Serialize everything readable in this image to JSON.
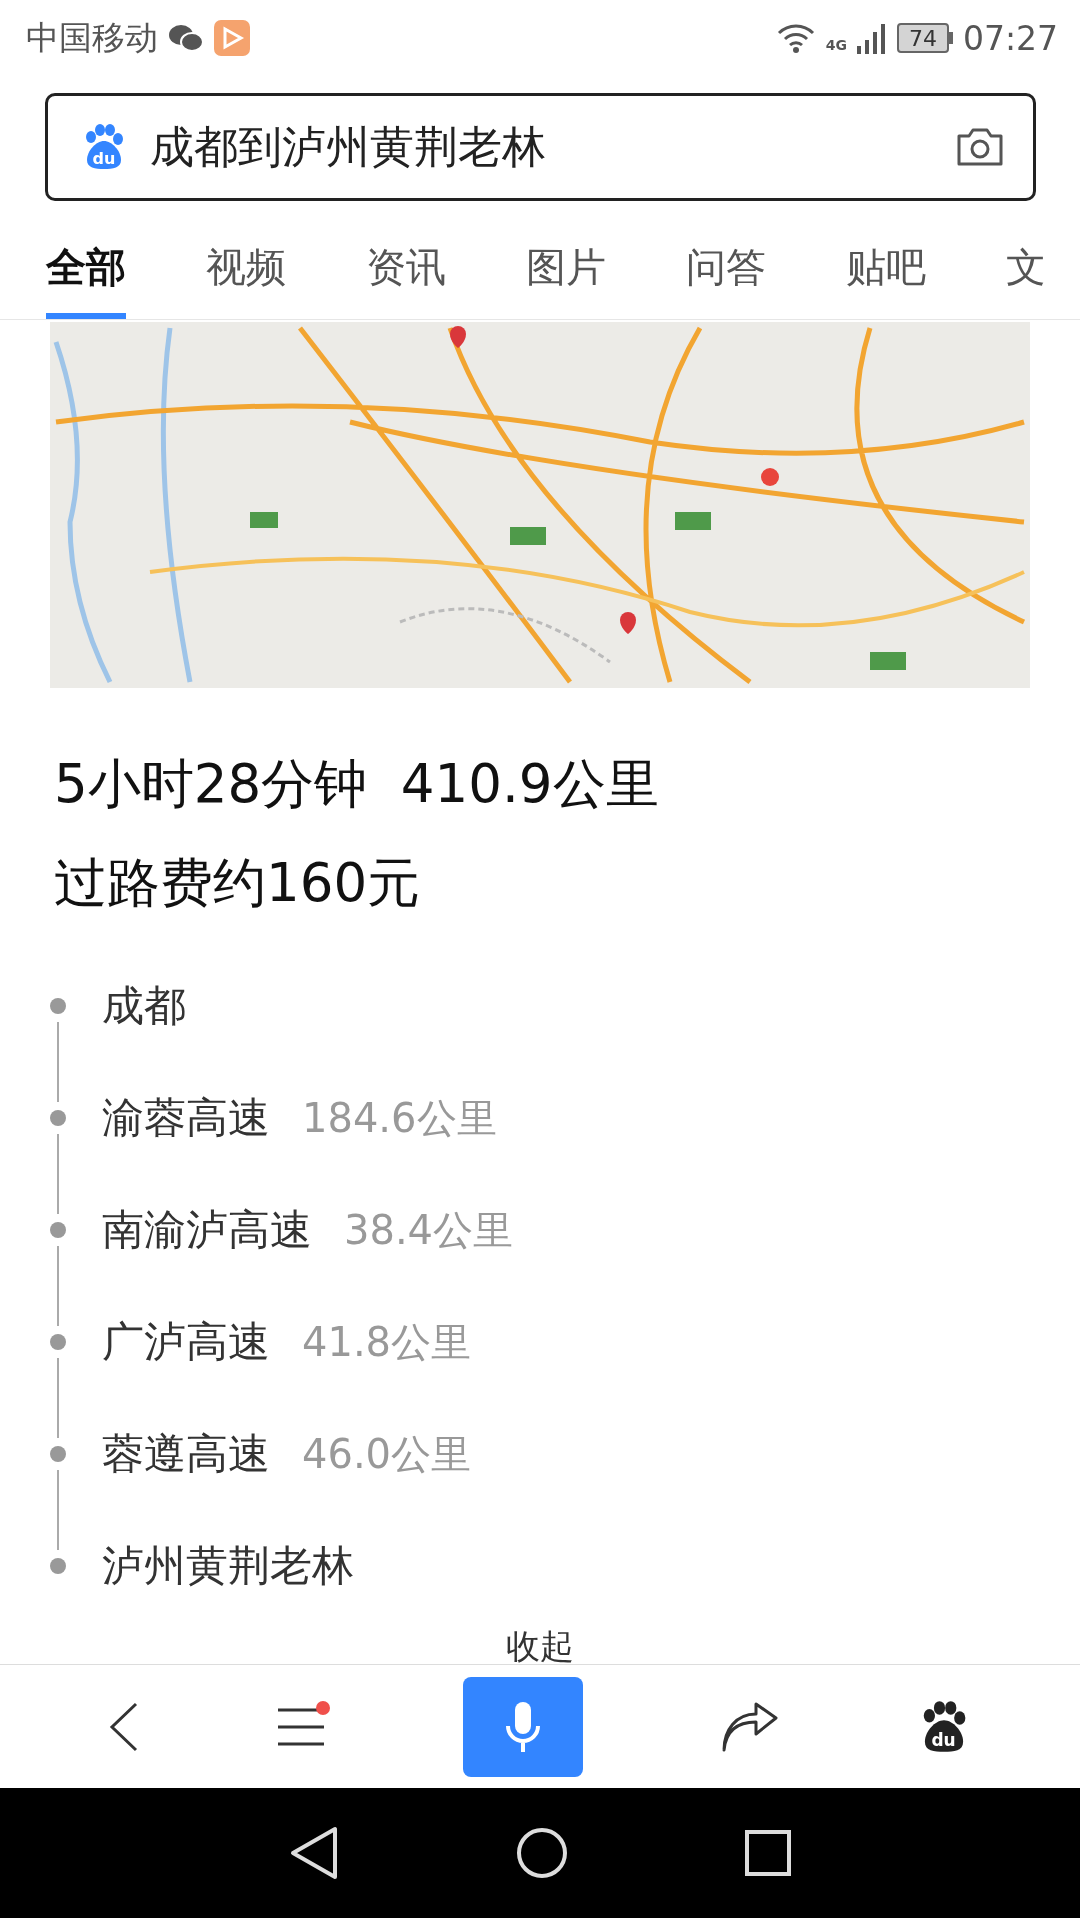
{
  "status_bar": {
    "carrier": "中国移动",
    "network": "4G",
    "battery": "74",
    "time": "07:27"
  },
  "search": {
    "logo_text": "du",
    "value": "成都到泸州黄荆老林"
  },
  "tabs": [
    {
      "label": "全部",
      "selected": true
    },
    {
      "label": "视频",
      "selected": false
    },
    {
      "label": "资讯",
      "selected": false
    },
    {
      "label": "图片",
      "selected": false
    },
    {
      "label": "问答",
      "selected": false
    },
    {
      "label": "贴吧",
      "selected": false
    },
    {
      "label": "文",
      "selected": false
    }
  ],
  "summary": {
    "duration_distance": "5小时28分钟  410.9公里",
    "toll": "过路费约160元"
  },
  "route": [
    {
      "name": "成都"
    },
    {
      "name": "渝蓉高速",
      "distance": "184.6公里"
    },
    {
      "name": "南渝泸高速",
      "distance": "38.4公里"
    },
    {
      "name": "广泸高速",
      "distance": "41.8公里"
    },
    {
      "name": "蓉遵高速",
      "distance": "46.0公里"
    },
    {
      "name": "泸州黄荆老林"
    }
  ],
  "collapse_link": "收起",
  "toolbar": {
    "menu_badge": true,
    "logo_text": "du"
  }
}
